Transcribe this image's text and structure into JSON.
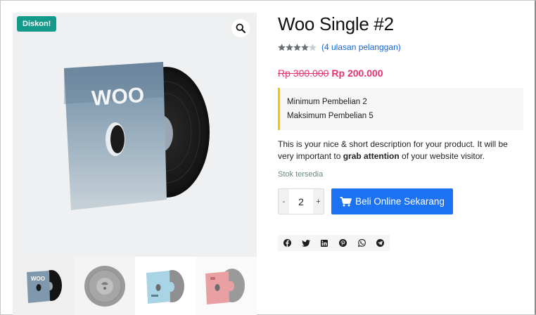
{
  "gallery": {
    "sale_badge": "Diskon!",
    "cover_text": "WOO",
    "thumbnails": [
      {
        "name": "thumb-woo-single",
        "cover_text": "WOO",
        "cover_color": "#7f98ad"
      },
      {
        "name": "thumb-grey-vinyl",
        "cover_text": "",
        "cover_color": "#a9a9a9"
      },
      {
        "name": "thumb-blue-vinyl",
        "cover_text": "",
        "cover_color": "#a9d4e6"
      },
      {
        "name": "thumb-pink-vinyl",
        "cover_text": "",
        "cover_color": "#e9a0a2"
      }
    ]
  },
  "product": {
    "title": "Woo Single #2",
    "rating": 4.5,
    "reviews_link": "(4 ulasan pelanggan)",
    "price_old": "Rp 300.000",
    "price_new": "Rp 200.000",
    "limits": {
      "min": "Minimum Pembelian 2",
      "max": "Maksimum Pembelian 5"
    },
    "description_pre": "This is your nice & short description for your product. It will be very important to ",
    "description_bold": "grab attention",
    "description_post": " of your website visitor.",
    "stock": "Stok tersedia"
  },
  "cart": {
    "minus": "-",
    "plus": "+",
    "quantity": "2",
    "buy_label": "Beli Online Sekarang"
  },
  "share": {
    "icons": [
      "facebook-icon",
      "twitter-icon",
      "linkedin-icon",
      "pinterest-icon",
      "whatsapp-icon",
      "telegram-icon"
    ]
  },
  "colors": {
    "badge": "#139a8b",
    "price": "#e8326e",
    "link": "#1565d8",
    "button": "#1b72f2",
    "limit_border": "#f2c600",
    "stock": "#6c8a80"
  }
}
